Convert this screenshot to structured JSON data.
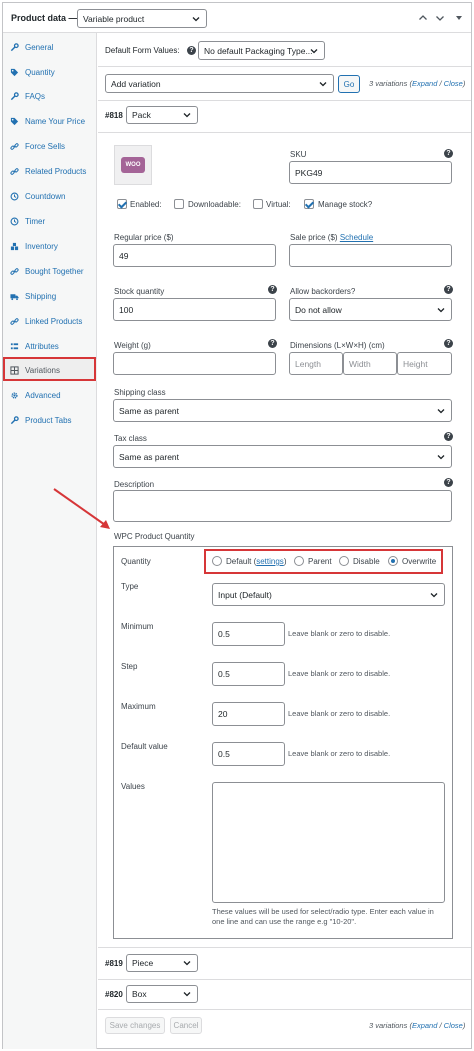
{
  "header": {
    "title": "Product data —",
    "product_type": "Variable product"
  },
  "sidebar": {
    "items": [
      {
        "label": "General",
        "icon": "wrench-icon"
      },
      {
        "label": "Quantity",
        "icon": "tag-icon"
      },
      {
        "label": "FAQs",
        "icon": "wrench-icon"
      },
      {
        "label": "Name Your Price",
        "icon": "tag-icon"
      },
      {
        "label": "Force Sells",
        "icon": "link-icon"
      },
      {
        "label": "Related Products",
        "icon": "link-icon"
      },
      {
        "label": "Countdown",
        "icon": "clock-icon"
      },
      {
        "label": "Timer",
        "icon": "clock-icon"
      },
      {
        "label": "Inventory",
        "icon": "inventory-icon"
      },
      {
        "label": "Bought Together",
        "icon": "link-icon"
      },
      {
        "label": "Shipping",
        "icon": "truck-icon"
      },
      {
        "label": "Linked Products",
        "icon": "link-icon"
      },
      {
        "label": "Attributes",
        "icon": "list-icon"
      },
      {
        "label": "Variations",
        "icon": "grid-icon"
      },
      {
        "label": "Advanced",
        "icon": "gear-icon"
      },
      {
        "label": "Product Tabs",
        "icon": "wrench-icon"
      }
    ]
  },
  "toolbar": {
    "default_form_values_label": "Default Form Values:",
    "default_form_select": "No default Packaging Type...",
    "add_variation_select": "Add variation",
    "go_label": "Go",
    "variations_count": "3 variations",
    "expand_label": "Expand",
    "sep": " / ",
    "close_label": "Close"
  },
  "variation818": {
    "id_label": "#818",
    "attr_value": "Pack",
    "thumb_text": "WOO",
    "sku_label": "SKU",
    "sku_value": "PKG49",
    "enabled_label": "Enabled:",
    "downloadable_label": "Downloadable:",
    "virtual_label": "Virtual:",
    "manage_stock_label": "Manage stock?",
    "regular_price_label": "Regular price ($)",
    "regular_price_value": "49",
    "sale_price_label": "Sale price ($)",
    "schedule_label": "Schedule",
    "stock_qty_label": "Stock quantity",
    "stock_qty_value": "100",
    "backorders_label": "Allow backorders?",
    "backorders_value": "Do not allow",
    "weight_label": "Weight (g)",
    "dimensions_label": "Dimensions (L×W×H) (cm)",
    "length_ph": "Length",
    "width_ph": "Width",
    "height_ph": "Height",
    "shipping_class_label": "Shipping class",
    "shipping_class_value": "Same as parent",
    "tax_class_label": "Tax class",
    "tax_class_value": "Same as parent",
    "description_label": "Description"
  },
  "wpc": {
    "section_title": "WPC Product Quantity",
    "quantity_label": "Quantity",
    "opt_default": "Default (",
    "opt_settings": "settings",
    "opt_default_end": ")",
    "opt_parent": "Parent",
    "opt_disable": "Disable",
    "opt_overwrite": "Overwrite",
    "type_label": "Type",
    "type_value": "Input (Default)",
    "minimum_label": "Minimum",
    "minimum_value": "0.5",
    "step_label": "Step",
    "step_value": "0.5",
    "maximum_label": "Maximum",
    "maximum_value": "20",
    "default_value_label": "Default value",
    "default_value_value": "0.5",
    "blank_hint": "Leave blank or zero to disable.",
    "values_label": "Values",
    "values_hint": "These values will be used for select/radio type. Enter each value in one line and can use the range e.g \"10-20\"."
  },
  "variation819": {
    "id_label": "#819",
    "attr_value": "Piece"
  },
  "variation820": {
    "id_label": "#820",
    "attr_value": "Box"
  },
  "footer": {
    "save_label": "Save changes",
    "cancel_label": "Cancel"
  },
  "colors": {
    "accent": "#2271b1",
    "highlight": "#d63638"
  }
}
